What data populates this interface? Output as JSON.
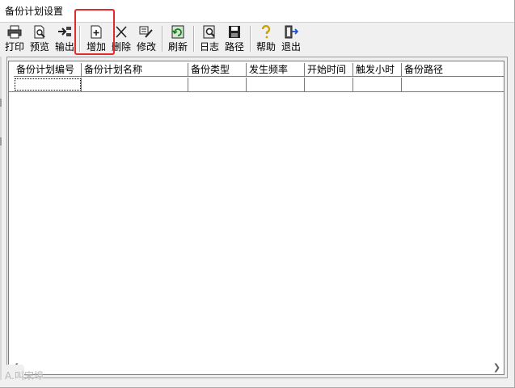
{
  "window": {
    "title": "备份计划设置"
  },
  "toolbar": {
    "buttons": [
      {
        "label": "打印",
        "icon": "printer-icon"
      },
      {
        "label": "预览",
        "icon": "preview-icon"
      },
      {
        "label": "输出",
        "icon": "export-icon"
      },
      {
        "label": "增加",
        "icon": "add-icon"
      },
      {
        "label": "删除",
        "icon": "delete-icon"
      },
      {
        "label": "修改",
        "icon": "edit-icon"
      },
      {
        "label": "刷新",
        "icon": "refresh-icon"
      },
      {
        "label": "日志",
        "icon": "log-icon"
      },
      {
        "label": "路径",
        "icon": "save-path-icon"
      },
      {
        "label": "帮助",
        "icon": "help-icon"
      },
      {
        "label": "退出",
        "icon": "exit-icon"
      }
    ],
    "highlight_color": "#e22a2a"
  },
  "grid": {
    "columns": [
      "备份计划编号",
      "备份计划名称",
      "备份类型",
      "发生频率",
      "开始时间",
      "触发小时",
      "备份路径"
    ],
    "rows": [
      [
        "",
        "",
        "",
        "",
        "",
        "",
        ""
      ]
    ]
  },
  "watermark": {
    "text": "A.叫宋埠"
  }
}
